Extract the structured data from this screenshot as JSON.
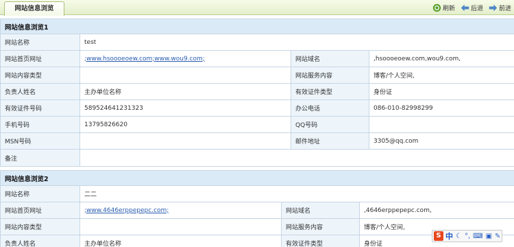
{
  "tab": {
    "label": "网站信息浏览"
  },
  "toolbar": {
    "refresh": "刷新",
    "back": "后退",
    "forward": "前进"
  },
  "section1": {
    "title": "网站信息浏览1",
    "site_name_label": "网站名称",
    "site_name": "test",
    "home_label": "网站首页网址",
    "home_url": ";www.hsoooeoew.com;www.wou9.com;",
    "domain_label": "网站域名",
    "domain": ",hsoooeoew.com,wou9.com,",
    "content_type_label": "网站内容类型",
    "content_type": "",
    "service_label": "网站服务内容",
    "service": "博客/个人空间,",
    "owner_label": "负责人姓名",
    "owner": "主办单位名称",
    "cert_type_label": "有效证件类型",
    "cert_type": "身份证",
    "cert_no_label": "有效证件号码",
    "cert_no": "589524641231323",
    "phone_label": "办公电话",
    "phone": "086-010-82998299",
    "mobile_label": "手机号码",
    "mobile": "13795826620",
    "qq_label": "QQ号码",
    "qq": "",
    "msn_label": "MSN号码",
    "msn": "",
    "email_label": "邮件地址",
    "email": "3305@qq.com",
    "note_label": "备注",
    "note": ""
  },
  "section2": {
    "title": "网站信息浏览2",
    "site_name_label": "网站名称",
    "site_name": "二二",
    "home_label": "网站首页网址",
    "home_url": ";www.4646erppepepc.com;",
    "domain_label": "网站域名",
    "domain": ",4646erppepepc.com,",
    "content_type_label": "网站内容类型",
    "content_type": "",
    "service_label": "网站服务内容",
    "service": "博客/个人空间,",
    "owner_label": "负责人姓名",
    "owner": "主办单位名称",
    "cert_type_label": "有效证件类型",
    "cert_type": "身份证"
  },
  "ime": {
    "lang": "中"
  }
}
